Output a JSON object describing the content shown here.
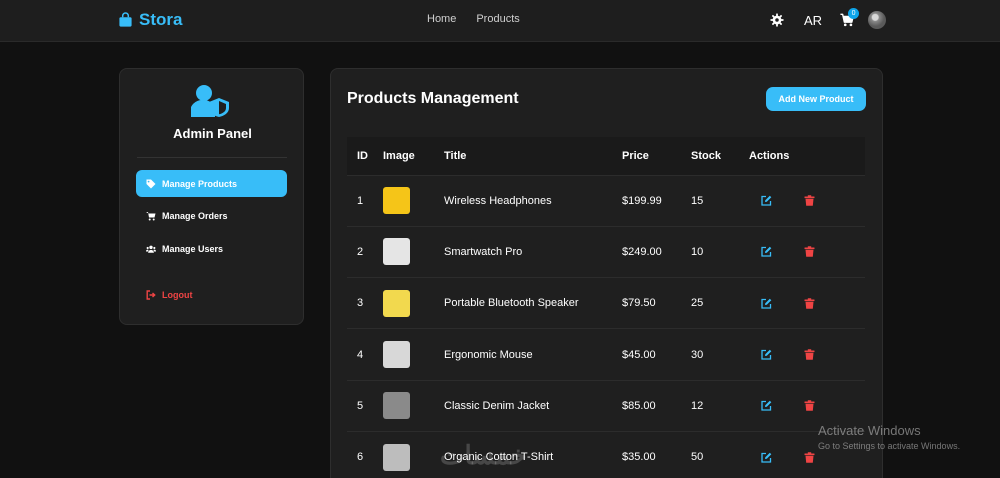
{
  "navbar": {
    "brand": "Stora",
    "links": [
      "Home",
      "Products"
    ],
    "lang": "AR",
    "cart_count": "0"
  },
  "sidebar": {
    "title": "Admin Panel",
    "items": [
      {
        "label": "Manage Products",
        "icon": "tag-icon",
        "active": true
      },
      {
        "label": "Manage Orders",
        "icon": "cart-icon"
      },
      {
        "label": "Manage Users",
        "icon": "users-icon"
      },
      {
        "label": "Logout",
        "icon": "logout-icon"
      }
    ]
  },
  "main": {
    "title": "Products Management",
    "add_button": "Add New Product",
    "columns": [
      "ID",
      "Image",
      "Title",
      "Price",
      "Stock",
      "Actions"
    ],
    "rows": [
      {
        "id": "1",
        "title": "Wireless Headphones",
        "price": "$199.99",
        "stock": "15",
        "thumb_color": "#f5c518"
      },
      {
        "id": "2",
        "title": "Smartwatch Pro",
        "price": "$249.00",
        "stock": "10",
        "thumb_color": "#e5e5e5"
      },
      {
        "id": "3",
        "title": "Portable Bluetooth Speaker",
        "price": "$79.50",
        "stock": "25",
        "thumb_color": "#f2d94e"
      },
      {
        "id": "4",
        "title": "Ergonomic Mouse",
        "price": "$45.00",
        "stock": "30",
        "thumb_color": "#d8d8d8"
      },
      {
        "id": "5",
        "title": "Classic Denim Jacket",
        "price": "$85.00",
        "stock": "12",
        "thumb_color": "#8a8a8a"
      },
      {
        "id": "6",
        "title": "Organic Cotton T-Shirt",
        "price": "$35.00",
        "stock": "50",
        "thumb_color": "#bdbdbd"
      }
    ]
  },
  "watermark": {
    "line1": "Activate Windows",
    "line2": "Go to Settings to activate Windows.",
    "site": "خمسات"
  },
  "colors": {
    "accent": "#38bdf8",
    "danger": "#ef4444",
    "background": "#111111",
    "panel": "#1f1f1f"
  }
}
